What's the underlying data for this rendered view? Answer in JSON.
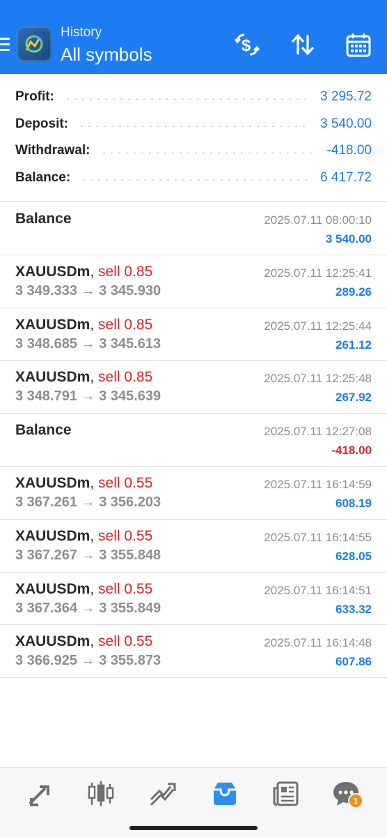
{
  "header": {
    "subtitle": "History",
    "title": "All symbols",
    "icons": [
      "menu-icon",
      "app-logo",
      "deposit-withdraw-icon",
      "sort-icon",
      "calendar-icon"
    ],
    "background": "#1e7cf2"
  },
  "summary": [
    {
      "label": "Profit:",
      "value": "3 295.72"
    },
    {
      "label": "Deposit:",
      "value": "3 540.00"
    },
    {
      "label": "Withdrawal:",
      "value": "-418.00"
    },
    {
      "label": "Balance:",
      "value": "6 417.72"
    }
  ],
  "deals": [
    {
      "type": "balance",
      "title": "Balance",
      "time": "2025.07.11 08:00:10",
      "amount": "3 540.00",
      "sign": "pos"
    },
    {
      "type": "trade",
      "symbol": "XAUUSDm",
      "separator": ",",
      "side": "sell 0.85",
      "open": "3 349.333",
      "arrow": "→",
      "close": "3 345.930",
      "time": "2025.07.11 12:25:41",
      "amount": "289.26",
      "sign": "pos"
    },
    {
      "type": "trade",
      "symbol": "XAUUSDm",
      "separator": ",",
      "side": "sell 0.85",
      "open": "3 348.685",
      "arrow": "→",
      "close": "3 345.613",
      "time": "2025.07.11 12:25:44",
      "amount": "261.12",
      "sign": "pos"
    },
    {
      "type": "trade",
      "symbol": "XAUUSDm",
      "separator": ",",
      "side": "sell 0.85",
      "open": "3 348.791",
      "arrow": "→",
      "close": "3 345.639",
      "time": "2025.07.11 12:25:48",
      "amount": "267.92",
      "sign": "pos"
    },
    {
      "type": "balance",
      "title": "Balance",
      "time": "2025.07.11 12:27:08",
      "amount": "-418.00",
      "sign": "neg"
    },
    {
      "type": "trade",
      "symbol": "XAUUSDm",
      "separator": ",",
      "side": "sell 0.55",
      "open": "3 367.261",
      "arrow": "→",
      "close": "3 356.203",
      "time": "2025.07.11 16:14:59",
      "amount": "608.19",
      "sign": "pos"
    },
    {
      "type": "trade",
      "symbol": "XAUUSDm",
      "separator": ",",
      "side": "sell 0.55",
      "open": "3 367.267",
      "arrow": "→",
      "close": "3 355.848",
      "time": "2025.07.11 16:14:55",
      "amount": "628.05",
      "sign": "pos"
    },
    {
      "type": "trade",
      "symbol": "XAUUSDm",
      "separator": ",",
      "side": "sell 0.55",
      "open": "3 367.364",
      "arrow": "→",
      "close": "3 355.849",
      "time": "2025.07.11 16:14:51",
      "amount": "633.32",
      "sign": "pos"
    },
    {
      "type": "trade",
      "symbol": "XAUUSDm",
      "separator": ",",
      "side": "sell 0.55",
      "open": "3 366.925",
      "arrow": "→",
      "close": "3 355.873",
      "time": "2025.07.11 16:14:48",
      "amount": "607.86",
      "sign": "pos"
    }
  ],
  "bottom_nav": {
    "items": [
      "quotes-icon",
      "chart-icon",
      "trade-icon",
      "history-icon",
      "news-icon",
      "chat-icon"
    ],
    "active": "history-icon",
    "chat_badge": "1",
    "active_color": "#2f8ff0",
    "inactive_color": "#6f6f6f"
  }
}
